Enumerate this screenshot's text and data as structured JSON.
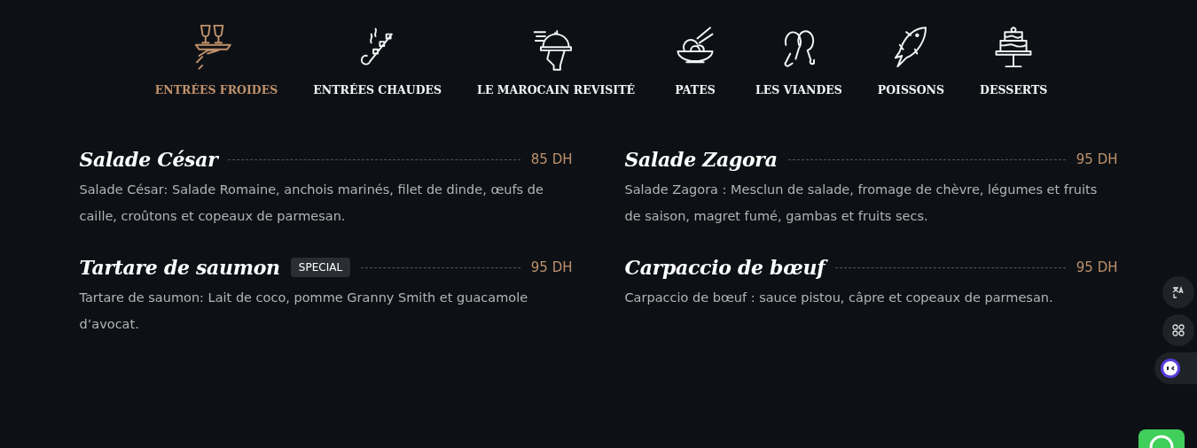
{
  "tabs": [
    {
      "label": "ENTRÉES FROIDES",
      "selected": true
    },
    {
      "label": "ENTRÉES CHAUDES",
      "selected": false
    },
    {
      "label": "LE MAROCAIN REVISITÉ",
      "selected": false
    },
    {
      "label": "PATES",
      "selected": false
    },
    {
      "label": "LES VIANDES",
      "selected": false
    },
    {
      "label": "POISSONS",
      "selected": false
    },
    {
      "label": "DESSERTS",
      "selected": false
    }
  ],
  "menu_items": [
    {
      "name": "Salade César",
      "price": "85 DH",
      "description": "Salade César: Salade Romaine, anchois marinés, filet de dinde, œufs de caille, croûtons et copeaux de parmesan."
    },
    {
      "name": "Salade Zagora",
      "price": "95 DH",
      "description": "Salade Zagora : Mesclun de salade, fromage de chèvre, légumes et fruits de saison, magret fumé, gambas et fruits secs."
    },
    {
      "name": "Tartare de saumon",
      "badge": "SPECIAL",
      "price": "95 DH",
      "description": "Tartare de saumon: Lait de coco, pomme Granny Smith et guacamole d’avocat."
    },
    {
      "name": "Carpaccio de bœuf",
      "price": "95 DH",
      "description": "Carpaccio de bœuf : sauce pistou, câpre et copeaux de parmesan."
    }
  ]
}
